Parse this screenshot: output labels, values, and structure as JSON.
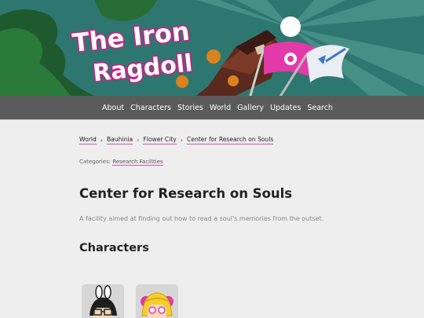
{
  "site": {
    "logo_text_line1": "The Iron",
    "logo_text_line2": "Ragdoll"
  },
  "nav": {
    "items": [
      "About",
      "Characters",
      "Stories",
      "World",
      "Gallery",
      "Updates",
      "Search"
    ]
  },
  "breadcrumb": {
    "items": [
      "World",
      "Bauhinia",
      "Flower City",
      "Center for Research on Souls"
    ],
    "separator": "›"
  },
  "categories": {
    "label": "Categories:",
    "items": [
      "Research Facilities"
    ]
  },
  "page": {
    "title": "Center for Research on Souls",
    "description": "A facility aimed at finding out how to read a soul's memories from the outset."
  },
  "characters_section": {
    "heading": "Characters",
    "cards": [
      {
        "icon": "character-portrait-icon"
      },
      {
        "icon": "character-portrait-icon"
      }
    ]
  },
  "colors": {
    "accent": "#e64bb5",
    "nav_bg": "#5b5b5b",
    "page_bg": "#eeeeee",
    "logo_fill": "#ffffff",
    "logo_outline": "#d9168a"
  }
}
